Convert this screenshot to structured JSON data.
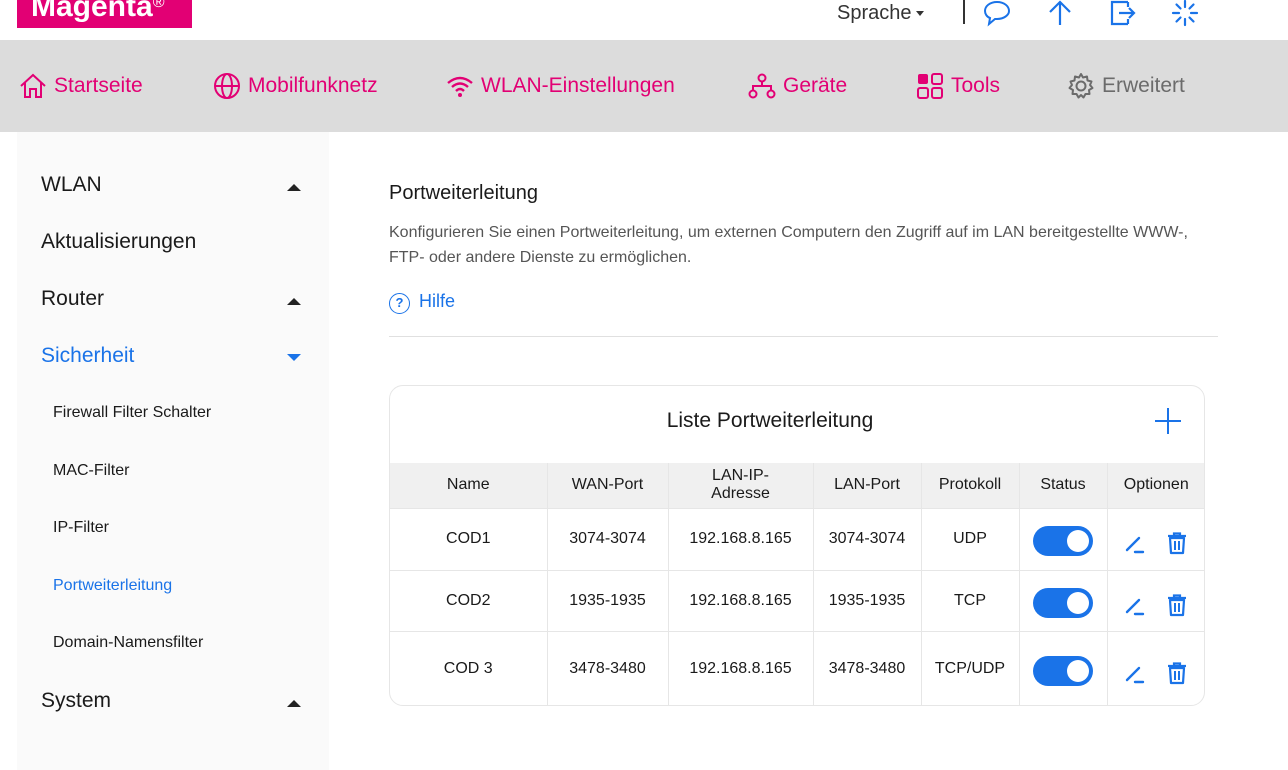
{
  "header": {
    "logo": "Magenta",
    "logo_mark": "®",
    "language_label": "Sprache",
    "icons": [
      "chat-icon",
      "upload-arrow-icon",
      "logout-icon",
      "loading-icon"
    ]
  },
  "nav": {
    "items": [
      {
        "label": "Startseite",
        "icon": "home-icon"
      },
      {
        "label": "Mobilfunknetz",
        "icon": "globe-icon"
      },
      {
        "label": "WLAN-Einstellungen",
        "icon": "wifi-icon"
      },
      {
        "label": "Geräte",
        "icon": "devices-icon"
      },
      {
        "label": "Tools",
        "icon": "tools-grid-icon"
      },
      {
        "label": "Erweitert",
        "icon": "gear-icon"
      }
    ]
  },
  "sidebar": {
    "groups": [
      {
        "label": "WLAN",
        "expanded": false
      },
      {
        "label": "Aktualisierungen"
      },
      {
        "label": "Router",
        "expanded": false
      },
      {
        "label": "Sicherheit",
        "expanded": true,
        "active": true
      },
      {
        "label": "System",
        "expanded": false
      }
    ],
    "security_items": [
      {
        "label": "Firewall Filter Schalter"
      },
      {
        "label": "MAC-Filter"
      },
      {
        "label": "IP-Filter"
      },
      {
        "label": "Portweiterleitung",
        "active": true
      },
      {
        "label": "Domain-Namensfilter"
      }
    ]
  },
  "main": {
    "title": "Portweiterleitung",
    "description": "Konfigurieren Sie einen Portweiterleitung, um externen Computern den Zugriff auf im LAN bereitgestellte WWW-, FTP- oder andere Dienste zu ermöglichen.",
    "help_label": "Hilfe",
    "card_title": "Liste Portweiterleitung",
    "columns": [
      "Name",
      "WAN-Port",
      "LAN-IP-Adresse",
      "LAN-Port",
      "Protokoll",
      "Status",
      "Optionen"
    ],
    "rows": [
      {
        "name": "COD1",
        "wan_port": "3074-3074",
        "lan_ip": "192.168.8.165",
        "lan_port": "3074-3074",
        "protocol": "UDP",
        "status": true
      },
      {
        "name": "COD2",
        "wan_port": "1935-1935",
        "lan_ip": "192.168.8.165",
        "lan_port": "1935-1935",
        "protocol": "TCP",
        "status": true
      },
      {
        "name": "COD 3",
        "wan_port": "3478-3480",
        "lan_ip": "192.168.8.165",
        "lan_port": "3478-3480",
        "protocol": "TCP/UDP",
        "status": true
      }
    ]
  },
  "colors": {
    "brand": "#e20074",
    "accent": "#1a73e8",
    "nav_background": "#dcdcdc"
  }
}
